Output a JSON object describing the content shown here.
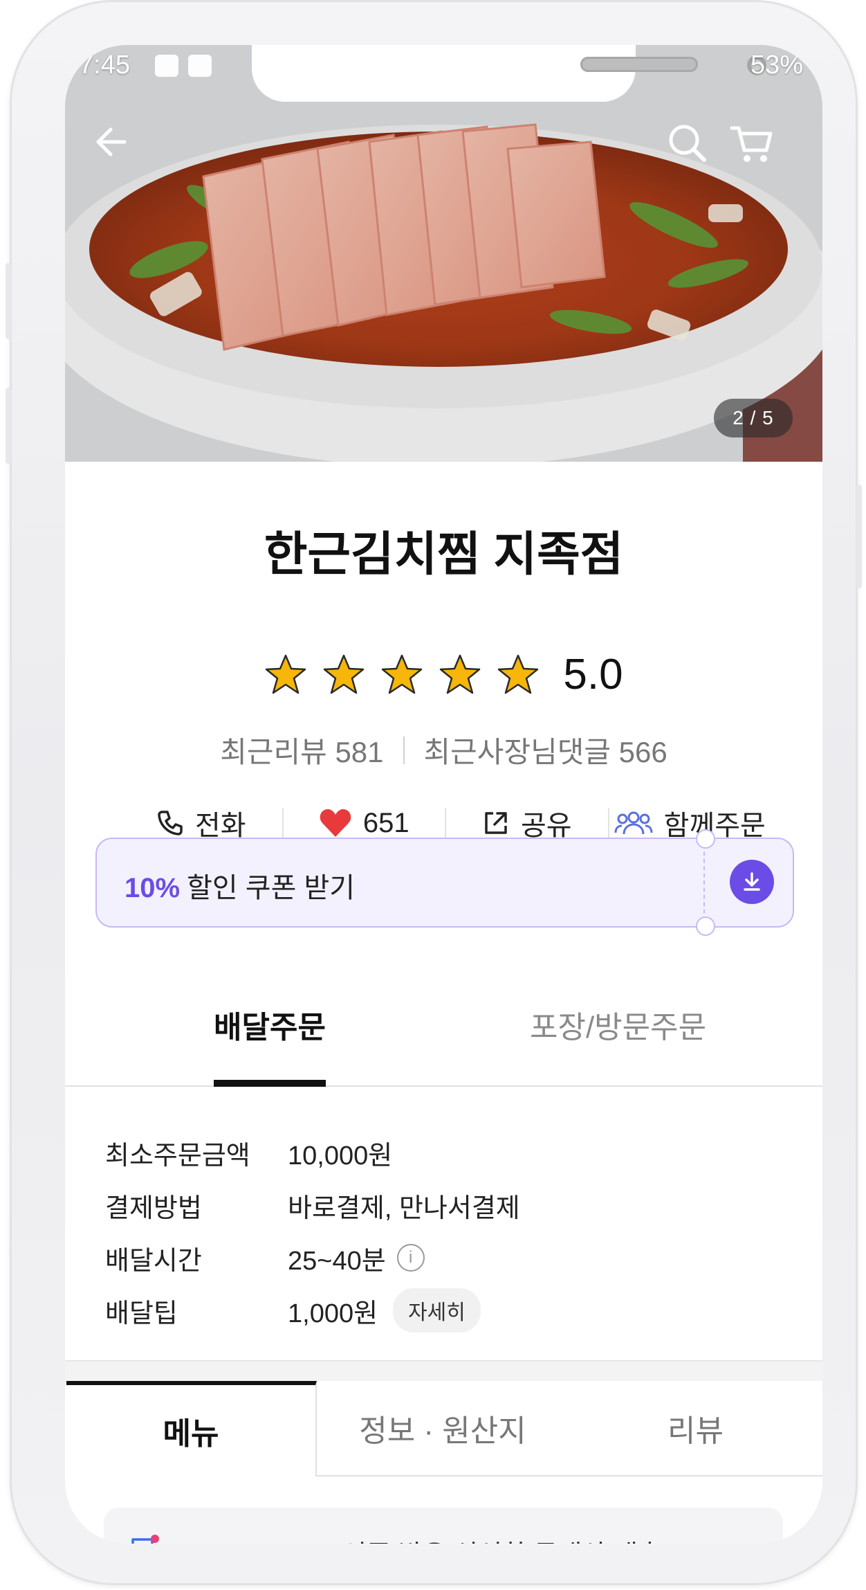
{
  "status_bar": {
    "time": "7:45",
    "battery": "53%"
  },
  "hero": {
    "pager": "2 / 5"
  },
  "store": {
    "name": "한근김치찜 지족점",
    "rating": "5.0",
    "stars": 5,
    "recent_reviews_label": "최근리뷰 581",
    "owner_replies_label": "최근사장님댓글 566"
  },
  "actions": {
    "call_label": "전화",
    "like_count": "651",
    "share_label": "공유",
    "group_order_label": "함께주문"
  },
  "coupon": {
    "percent": "10%",
    "label": "할인 쿠폰 받기"
  },
  "order_tabs": {
    "delivery": "배달주문",
    "pickup": "포장/방문주문"
  },
  "delivery_info": [
    {
      "key": "최소주문금액",
      "value": "10,000원"
    },
    {
      "key": "결제방법",
      "value": "바로결제, 만나서결제"
    },
    {
      "key": "배달시간",
      "value": "25~40분"
    },
    {
      "key": "배달팁",
      "value": "1,000원",
      "chip": "자세히"
    }
  ],
  "menu_tabs": {
    "menu": "메뉴",
    "info": "정보 · 원산지",
    "review": "리뷰"
  },
  "notice": {
    "text": "ʚ◡ɞ HACCP 인증 받은 신선한 국내산 배추김치를 사용합니다 ♪"
  },
  "colors": {
    "accent": "#6c4ce6",
    "heart": "#e83a3a",
    "star": "#f6b60a"
  }
}
